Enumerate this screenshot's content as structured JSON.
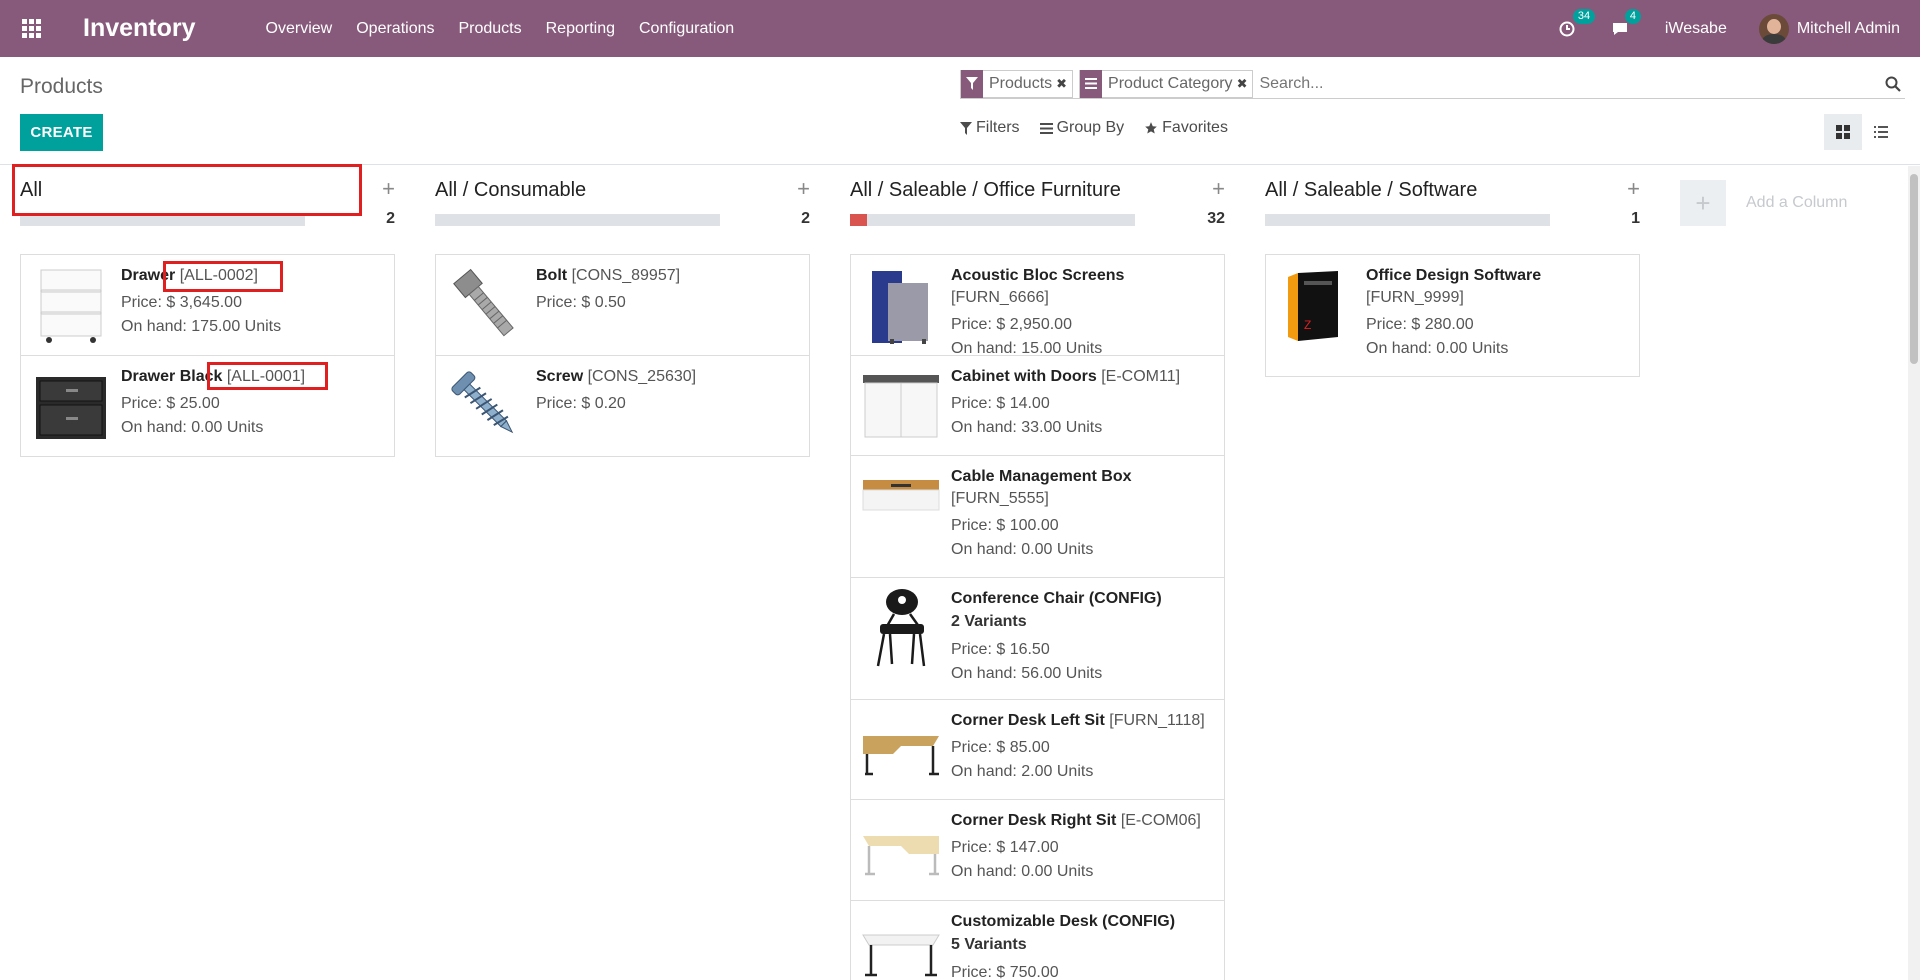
{
  "app": {
    "name": "Inventory",
    "menu": [
      "Overview",
      "Operations",
      "Products",
      "Reporting",
      "Configuration"
    ],
    "activities_count": "34",
    "messages_count": "4",
    "company": "iWesabe",
    "user": "Mitchell Admin"
  },
  "control": {
    "breadcrumb": "Products",
    "create_label": "CREATE",
    "facets": [
      {
        "label": "Products",
        "icon": "filter-icon"
      },
      {
        "label": "Product Category",
        "icon": "group-by-icon"
      }
    ],
    "search_placeholder": "Search...",
    "filters_label": "Filters",
    "groupby_label": "Group By",
    "favorites_label": "Favorites"
  },
  "columns": [
    {
      "title": "All",
      "count": "2",
      "progress": 0,
      "cards": [
        {
          "name": "Drawer",
          "ref": "[ALL-0002]",
          "variants": "",
          "price": "Price: $ 3,645.00",
          "onhand": "On hand: 175.00 Units",
          "image": "white-drawer"
        },
        {
          "name": "Drawer Black",
          "ref": "[ALL-0001]",
          "variants": "",
          "price": "Price: $ 25.00",
          "onhand": "On hand: 0.00 Units",
          "image": "black-drawer"
        }
      ]
    },
    {
      "title": "All / Consumable",
      "count": "2",
      "progress": 0,
      "cards": [
        {
          "name": "Bolt",
          "ref": "[CONS_89957]",
          "variants": "",
          "price": "Price: $ 0.50",
          "onhand": "",
          "image": "bolt"
        },
        {
          "name": "Screw",
          "ref": "[CONS_25630]",
          "variants": "",
          "price": "Price: $ 0.20",
          "onhand": "",
          "image": "screw"
        }
      ]
    },
    {
      "title": "All / Saleable / Office Furniture",
      "count": "32",
      "progress": 0.06,
      "cards": [
        {
          "name": "Acoustic Bloc Screens",
          "ref": "[FURN_6666]",
          "variants": "",
          "price": "Price: $ 2,950.00",
          "onhand": "On hand: 15.00 Units",
          "image": "screens"
        },
        {
          "name": "Cabinet with Doors",
          "ref": "[E-COM11]",
          "variants": "",
          "price": "Price: $ 14.00",
          "onhand": "On hand: 33.00 Units",
          "image": "cabinet"
        },
        {
          "name": "Cable Management Box",
          "ref": "[FURN_5555]",
          "variants": "",
          "price": "Price: $ 100.00",
          "onhand": "On hand: 0.00 Units",
          "image": "cable-box"
        },
        {
          "name": "Conference Chair (CONFIG)",
          "ref": "",
          "variants": "2 Variants",
          "price": "Price: $ 16.50",
          "onhand": "On hand: 56.00 Units",
          "image": "chair"
        },
        {
          "name": "Corner Desk Left Sit",
          "ref": "[FURN_1118]",
          "variants": "",
          "price": "Price: $ 85.00",
          "onhand": "On hand: 2.00 Units",
          "image": "desk-left"
        },
        {
          "name": "Corner Desk Right Sit",
          "ref": "[E-COM06]",
          "variants": "",
          "price": "Price: $ 147.00",
          "onhand": "On hand: 0.00 Units",
          "image": "desk-right"
        },
        {
          "name": "Customizable Desk (CONFIG)",
          "ref": "",
          "variants": "5 Variants",
          "price": "Price: $ 750.00",
          "onhand": "",
          "image": "desk-custom"
        }
      ]
    },
    {
      "title": "All / Saleable / Software",
      "count": "1",
      "progress": 0,
      "cards": [
        {
          "name": "Office Design Software",
          "ref": "[FURN_9999]",
          "variants": "",
          "price": "Price: $ 280.00",
          "onhand": "On hand: 0.00 Units",
          "image": "software-box"
        }
      ]
    }
  ],
  "add_column_label": "Add a Column"
}
